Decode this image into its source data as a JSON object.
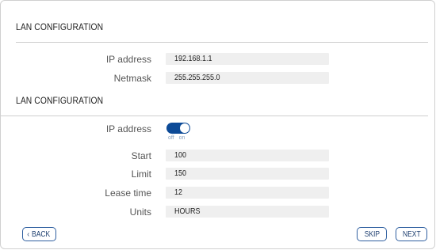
{
  "section1": {
    "title": "LAN CONFIGURATION",
    "rows": [
      {
        "label": "IP address",
        "value": "192.168.1.1"
      },
      {
        "label": "Netmask",
        "value": "255.255.255.0"
      }
    ]
  },
  "section2": {
    "title": "LAN CONFIGURATION",
    "dhcp_toggle": {
      "label": "IP address",
      "state": "on",
      "off_label": "off",
      "on_label": "on"
    },
    "rows": [
      {
        "label": "Start",
        "value": "100"
      },
      {
        "label": "Limit",
        "value": "150"
      },
      {
        "label": "Lease time",
        "value": "12"
      },
      {
        "label": "Units",
        "value": "HOURS"
      }
    ]
  },
  "buttons": {
    "back": "BACK",
    "back_icon": "chevron-left-icon",
    "skip": "SKIP",
    "next": "NEXT"
  },
  "colors": {
    "accent": "#0c4a97",
    "button_border": "#2f5fa0",
    "field_bg": "#efefef"
  }
}
